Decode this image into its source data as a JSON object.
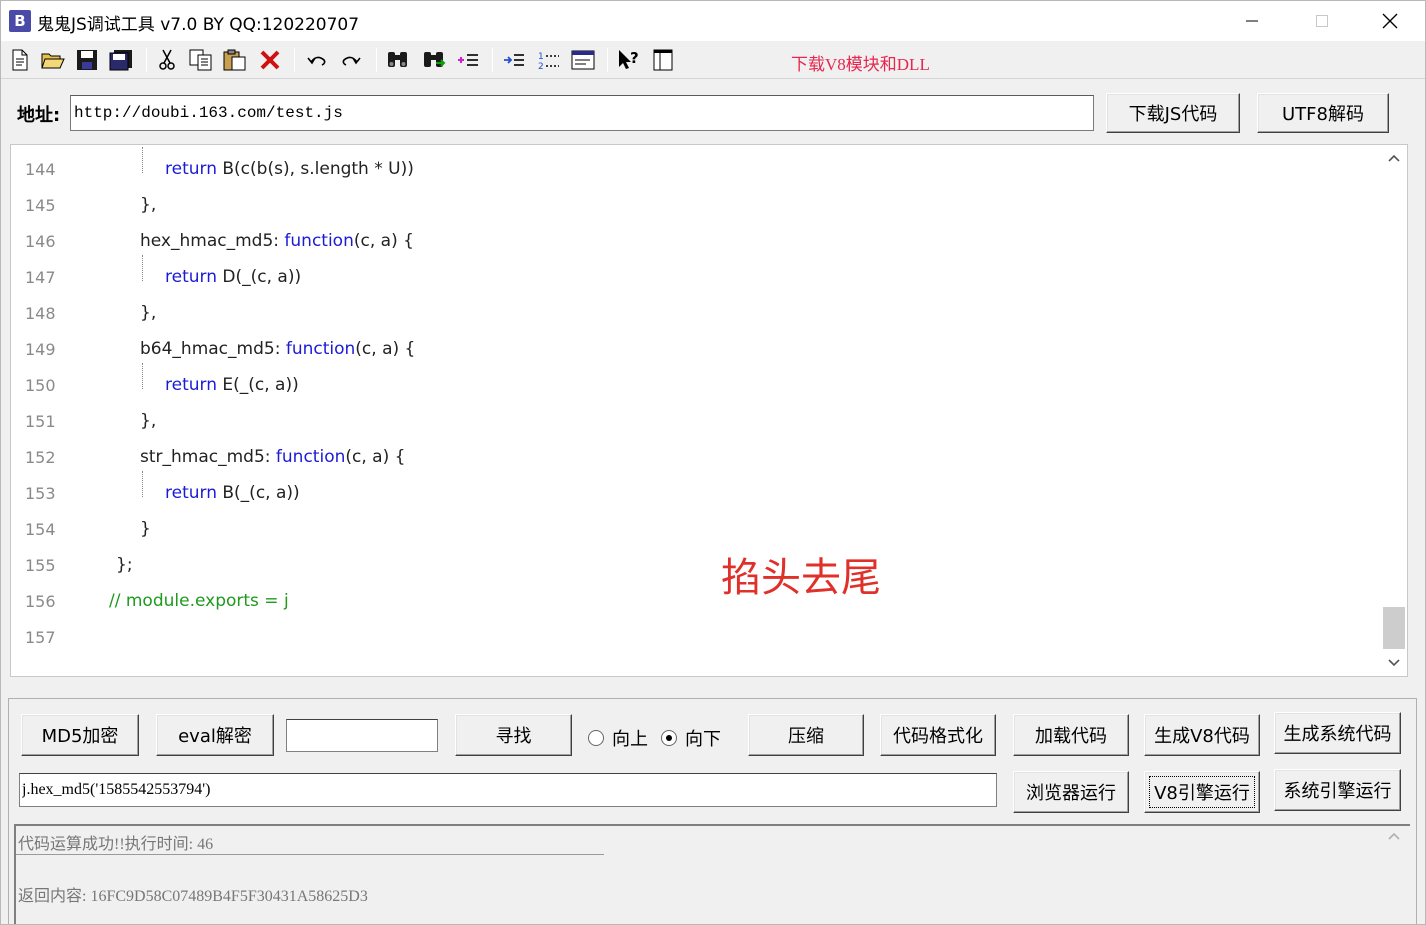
{
  "window": {
    "title": "鬼鬼JS调试工具 v7.0 BY QQ:120220707",
    "app_icon_letter": "B"
  },
  "toolbar": {
    "icons": [
      "new-file-icon",
      "open-folder-icon",
      "save-icon",
      "save-all-icon",
      "cut-icon",
      "copy-icon",
      "paste-icon",
      "delete-icon",
      "undo-icon",
      "redo-icon",
      "find-icon",
      "find-next-icon",
      "list-icon",
      "indent-icon",
      "numbered-list-icon",
      "window-icon",
      "help-pointer-icon",
      "panel-icon"
    ],
    "download_link": "下载V8模块和DLL",
    "download_link_color": "#e8264e"
  },
  "address": {
    "label": "地址:",
    "value": "http://doubi.163.com/test.js",
    "download_button": "下载JS代码",
    "utf8_button": "UTF8解码"
  },
  "editor": {
    "lines": [
      {
        "num": "144",
        "parts": [
          {
            "t": "return",
            "k": "kw"
          },
          {
            "t": " B(c(b(s), s.length * U))",
            "k": ""
          }
        ]
      },
      {
        "num": "145",
        "parts": [
          {
            "t": "},",
            "k": ""
          }
        ]
      },
      {
        "num": "146",
        "parts": [
          {
            "t": "hex_hmac_md5: ",
            "k": ""
          },
          {
            "t": "function",
            "k": "kw"
          },
          {
            "t": "(c, a) {",
            "k": ""
          }
        ]
      },
      {
        "num": "147",
        "parts": [
          {
            "t": "return",
            "k": "kw"
          },
          {
            "t": " D(_(c, a))",
            "k": ""
          }
        ]
      },
      {
        "num": "148",
        "parts": [
          {
            "t": "},",
            "k": ""
          }
        ]
      },
      {
        "num": "149",
        "parts": [
          {
            "t": "b64_hmac_md5: ",
            "k": ""
          },
          {
            "t": "function",
            "k": "kw"
          },
          {
            "t": "(c, a) {",
            "k": ""
          }
        ]
      },
      {
        "num": "150",
        "parts": [
          {
            "t": "return",
            "k": "kw"
          },
          {
            "t": " E(_(c, a))",
            "k": ""
          }
        ]
      },
      {
        "num": "151",
        "parts": [
          {
            "t": "},",
            "k": ""
          }
        ]
      },
      {
        "num": "152",
        "parts": [
          {
            "t": "str_hmac_md5: ",
            "k": ""
          },
          {
            "t": "function",
            "k": "kw"
          },
          {
            "t": "(c, a) {",
            "k": ""
          }
        ]
      },
      {
        "num": "153",
        "parts": [
          {
            "t": "return",
            "k": "kw"
          },
          {
            "t": " B(_(c, a))",
            "k": ""
          }
        ]
      },
      {
        "num": "154",
        "parts": [
          {
            "t": "}",
            "k": ""
          }
        ]
      },
      {
        "num": "155",
        "parts": [
          {
            "t": "};",
            "k": ""
          }
        ]
      },
      {
        "num": "156",
        "parts": [
          {
            "t": "// module.exports = j",
            "k": "cm"
          }
        ]
      },
      {
        "num": "157",
        "parts": []
      }
    ],
    "watermark": "掐头去尾",
    "keyword_color": "#1b1bd6",
    "comment_color": "#1e9a1e"
  },
  "controls": {
    "md5_button": "MD5加密",
    "eval_button": "eval解密",
    "find_input_value": "",
    "find_button": "寻找",
    "radio_up": "向上",
    "radio_down": "向下",
    "direction_selected": "down",
    "compress_button": "压缩",
    "format_button": "代码格式化",
    "load_button": "加载代码",
    "gen_v8_button": "生成V8代码",
    "gen_sys_button": "生成系统代码",
    "expression": "j.hex_md5('1585542553794')",
    "browser_run_button": "浏览器运行",
    "v8_run_button": "V8引擎运行",
    "sys_run_button": "系统引擎运行"
  },
  "output": {
    "line1": "代码运算成功!!执行时间: 46",
    "line2": "返回内容: 16FC9D58C07489B4F5F30431A58625D3"
  }
}
